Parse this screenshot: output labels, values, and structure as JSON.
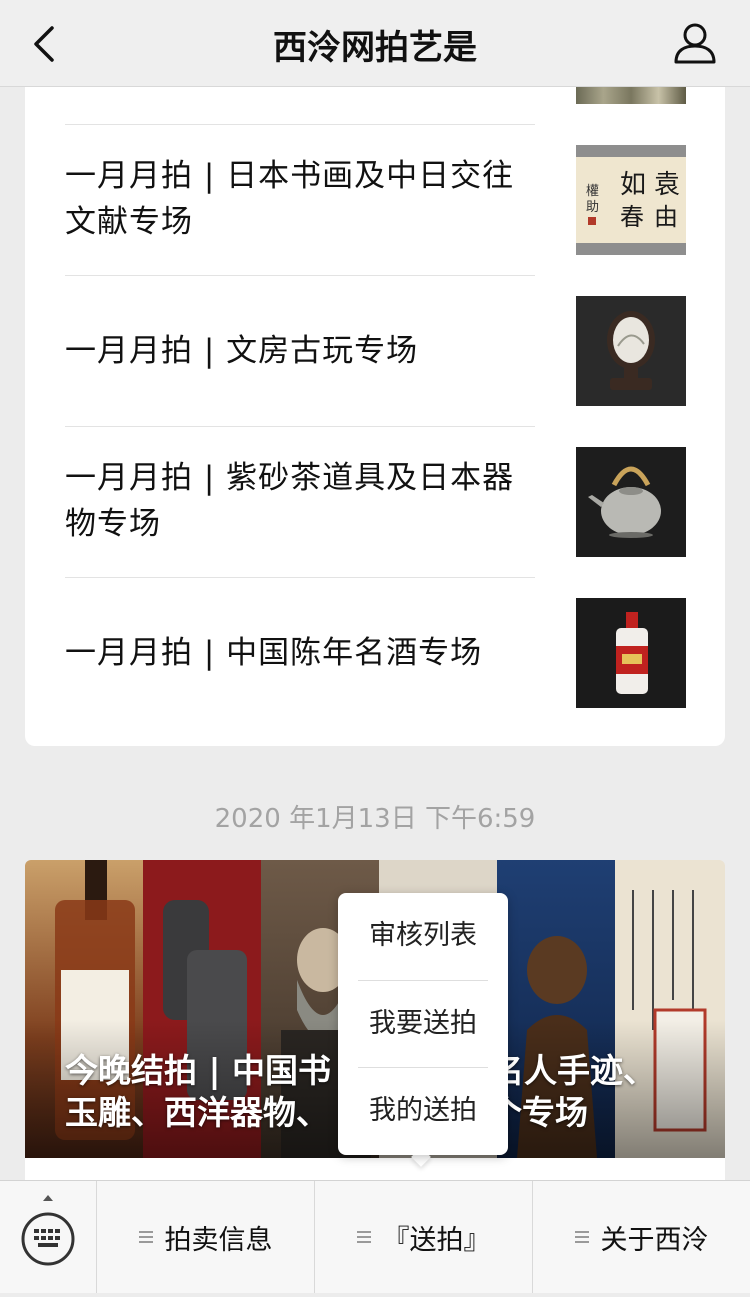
{
  "header": {
    "title": "西泠网拍艺是",
    "back_icon": "chevron-left-icon",
    "profile_icon": "person-icon"
  },
  "articles": [
    {
      "title_lines": [
        "一月月拍 | 日本书画及中日交往",
        "文献专场"
      ],
      "thumb": "calligraphy-scroll"
    },
    {
      "title_lines": [
        "一月月拍 | 文房古玩专场"
      ],
      "thumb": "table-screen"
    },
    {
      "title_lines": [
        "一月月拍 | 紫砂茶道具及日本器",
        "物专场"
      ],
      "thumb": "silver-teapot"
    },
    {
      "title_lines": [
        "一月月拍 | 中国陈年名酒专场"
      ],
      "thumb": "moutai-bottle"
    }
  ],
  "timestamp": "2020 年1月13日 下午6:59",
  "banner": {
    "title_lines": [
      "今晚结拍 | 中国书",
      "玉雕、西洋器物、"
    ],
    "title_tail_lines": [
      "名人手迹、",
      "个专场"
    ]
  },
  "popup_menu": {
    "items": [
      "审核列表",
      "我要送拍",
      "我的送拍"
    ]
  },
  "tabbar": {
    "keyboard_icon": "keyboard-icon",
    "tabs": [
      {
        "label": "拍卖信息"
      },
      {
        "label": "『送拍』"
      },
      {
        "label": "关于西泠"
      }
    ]
  },
  "colors": {
    "background": "#ececec",
    "card": "#ffffff",
    "timestamp": "#a3a3a3"
  }
}
